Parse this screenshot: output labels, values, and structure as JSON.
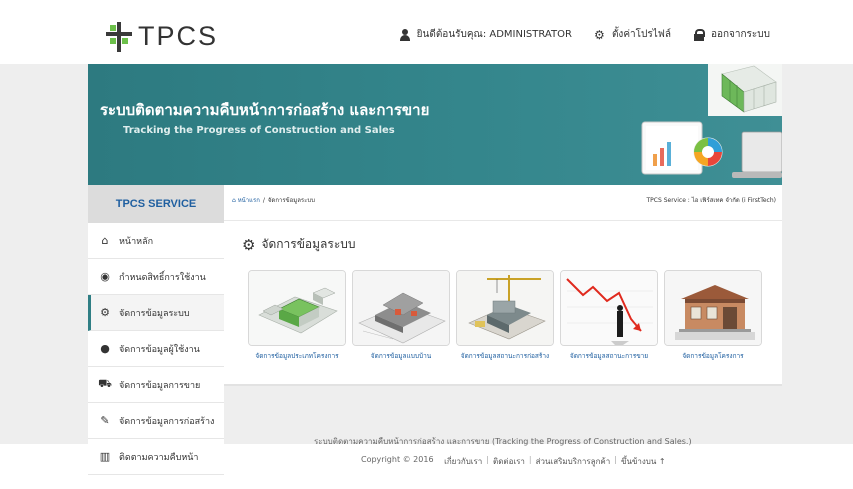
{
  "header": {
    "logo_text": "TPCS",
    "welcome": "ยินดีต้อนรับคุณ: ADMINISTRATOR",
    "profile_settings": "ตั้งค่าโปรไฟล์",
    "logout": "ออกจากระบบ"
  },
  "banner": {
    "title_th": "ระบบติดตามความคืบหน้าการก่อสร้าง และการขาย",
    "title_en": "Tracking the Progress of Construction and Sales"
  },
  "sidebar": {
    "title": "TPCS SERVICE",
    "items": [
      {
        "label": "หน้าหลัก",
        "icon": "home-icon"
      },
      {
        "label": "กำหนดสิทธิ์การใช้งาน",
        "icon": "eye-icon"
      },
      {
        "label": "จัดการข้อมูลระบบ",
        "icon": "gears-icon"
      },
      {
        "label": "จัดการข้อมูลผู้ใช้งาน",
        "icon": "user-icon"
      },
      {
        "label": "จัดการข้อมูลการขาย",
        "icon": "cart-icon"
      },
      {
        "label": "จัดการข้อมูลการก่อสร้าง",
        "icon": "wrench-icon"
      },
      {
        "label": "ติดตามความคืบหน้า",
        "icon": "bar-chart-icon"
      }
    ]
  },
  "breadcrumb": {
    "home": "หน้าแรก",
    "separator": "/",
    "current": "จัดการข้อมูลระบบ",
    "service": "TPCS Service : ไอ เฟิร์สเทค จำกัด (i FirstTech)"
  },
  "panel": {
    "title": "จัดการข้อมูลระบบ",
    "tiles": [
      {
        "label": "จัดการข้อมูลประเภทโครงการ"
      },
      {
        "label": "จัดการข้อมูลแบบบ้าน"
      },
      {
        "label": "จัดการข้อมูลสถานะการก่อสร้าง"
      },
      {
        "label": "จัดการข้อมูลสถานะการขาย"
      },
      {
        "label": "จัดการข้อมูลโครงการ"
      }
    ]
  },
  "footer": {
    "line1": "ระบบติดตามความคืบหน้าการก่อสร้าง และการขาย  (Tracking the Progress of Construction and Sales.)",
    "copyright": "Copyright © 2016",
    "links": [
      "เกี่ยวกับเรา",
      "ติดต่อเรา",
      "ส่วนเสริมบริการลูกค้า",
      "ขึ้นข้างบน ↑"
    ]
  }
}
